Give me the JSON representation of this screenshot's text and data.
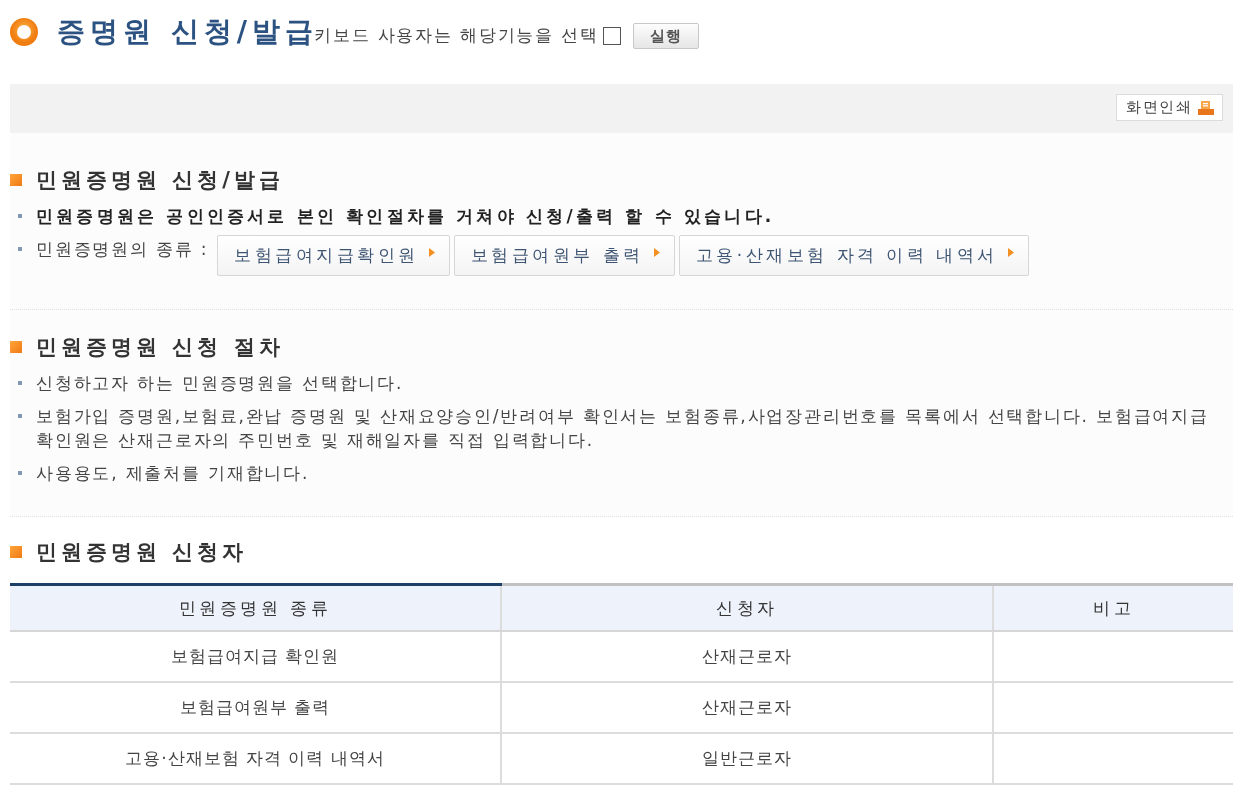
{
  "header": {
    "title": "증명원 신청/발급",
    "keyboard_label": "키보드 사용자는 해당기능을 선택",
    "keyboard_checkbox": {
      "checked": false
    },
    "run_button": "실행"
  },
  "toolbar": {
    "print_button": "화면인쇄"
  },
  "sections": [
    {
      "heading": "민원증명원 신청/발급",
      "items": [
        {
          "kind": "strong",
          "text": "민원증명원은 공인인증서로 본인 확인절차를 거쳐야 신청/출력 할 수 있습니다."
        },
        {
          "kind": "links",
          "text": "민원증명원의 종류 :",
          "links": [
            "보험급여지급확인원",
            "보험급여원부 출력",
            "고용·산재보험 자격 이력 내역서"
          ]
        }
      ]
    },
    {
      "heading": "민원증명원 신청 절차",
      "items": [
        {
          "kind": "text",
          "text": "신청하고자 하는 민원증명원을 선택합니다."
        },
        {
          "kind": "text",
          "text": "보험가입 증명원,보험료,완납 증명원 및 산재요양승인/반려여부 확인서는 보험종류,사업장관리번호를 목록에서 선택합니다. 보험급여지급 확인원은 산재근로자의 주민번호 및 재해일자를 직접 입력합니다."
        },
        {
          "kind": "text",
          "text": "사용용도, 제출처를 기재합니다."
        }
      ]
    },
    {
      "heading": "민원증명원 신청자",
      "table": {
        "columns": [
          "민원증명원 종류",
          "신청자",
          "비고"
        ],
        "rows": [
          [
            "보험급여지급 확인원",
            "산재근로자",
            ""
          ],
          [
            "보험급여원부 출력",
            "산재근로자",
            ""
          ],
          [
            "고용·산재보험 자격 이력 내역서",
            "일반근로자",
            ""
          ]
        ]
      }
    }
  ]
}
